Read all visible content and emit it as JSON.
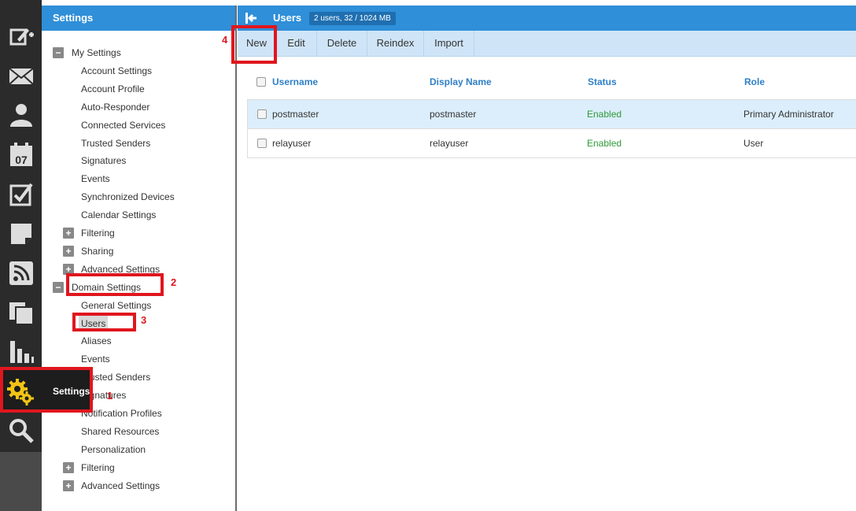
{
  "rail": {
    "items": [
      {
        "icon": "compose-icon"
      },
      {
        "icon": "mail-icon"
      },
      {
        "icon": "contacts-icon"
      },
      {
        "icon": "calendar-icon",
        "day": "07"
      },
      {
        "icon": "tasks-icon"
      },
      {
        "icon": "notes-icon"
      },
      {
        "icon": "rss-icon"
      },
      {
        "icon": "files-icon"
      },
      {
        "icon": "reports-icon"
      },
      {
        "icon": "settings-gear-icon"
      },
      {
        "icon": "search-icon"
      }
    ],
    "settings_button_label": "Settings"
  },
  "nav": {
    "title": "Settings",
    "tree": [
      {
        "label": "My Settings",
        "level": 0,
        "toggle": "−"
      },
      {
        "label": "Account Settings",
        "level": 1
      },
      {
        "label": "Account Profile",
        "level": 1
      },
      {
        "label": "Auto-Responder",
        "level": 1
      },
      {
        "label": "Connected Services",
        "level": 1
      },
      {
        "label": "Trusted Senders",
        "level": 1
      },
      {
        "label": "Signatures",
        "level": 1
      },
      {
        "label": "Events",
        "level": 1
      },
      {
        "label": "Synchronized Devices",
        "level": 1
      },
      {
        "label": "Calendar Settings",
        "level": 1
      },
      {
        "label": "Filtering",
        "level": 1,
        "toggle": "+"
      },
      {
        "label": "Sharing",
        "level": 1,
        "toggle": "+"
      },
      {
        "label": "Advanced Settings",
        "level": 1,
        "toggle": "+"
      },
      {
        "label": "Domain Settings",
        "level": 0,
        "toggle": "−"
      },
      {
        "label": "General Settings",
        "level": 1
      },
      {
        "label": "Users",
        "level": 1,
        "selected": true
      },
      {
        "label": "Aliases",
        "level": 1
      },
      {
        "label": "Events",
        "level": 1
      },
      {
        "label": "Trusted Senders",
        "level": 1
      },
      {
        "label": "Signatures",
        "level": 1
      },
      {
        "label": "Notification Profiles",
        "level": 1
      },
      {
        "label": "Shared Resources",
        "level": 1
      },
      {
        "label": "Personalization",
        "level": 1
      },
      {
        "label": "Filtering",
        "level": 1,
        "toggle": "+"
      },
      {
        "label": "Advanced Settings",
        "level": 1,
        "toggle": "+"
      }
    ]
  },
  "main": {
    "title": "Users",
    "badge": "2 users, 32 / 1024 MB",
    "toolbar": {
      "new": "New",
      "edit": "Edit",
      "delete": "Delete",
      "reindex": "Reindex",
      "import": "Import"
    },
    "columns": {
      "username": "Username",
      "display_name": "Display Name",
      "status": "Status",
      "role": "Role"
    },
    "rows": [
      {
        "username": "postmaster",
        "display_name": "postmaster",
        "status": "Enabled",
        "role": "Primary Administrator"
      },
      {
        "username": "relayuser",
        "display_name": "relayuser",
        "status": "Enabled",
        "role": "User"
      }
    ]
  },
  "annotations": {
    "n1": "1",
    "n2": "2",
    "n3": "3",
    "n4": "4"
  },
  "colors": {
    "accent": "#2f8fd8",
    "annotation": "#e0161e",
    "status_enabled": "#2e9a3a"
  }
}
